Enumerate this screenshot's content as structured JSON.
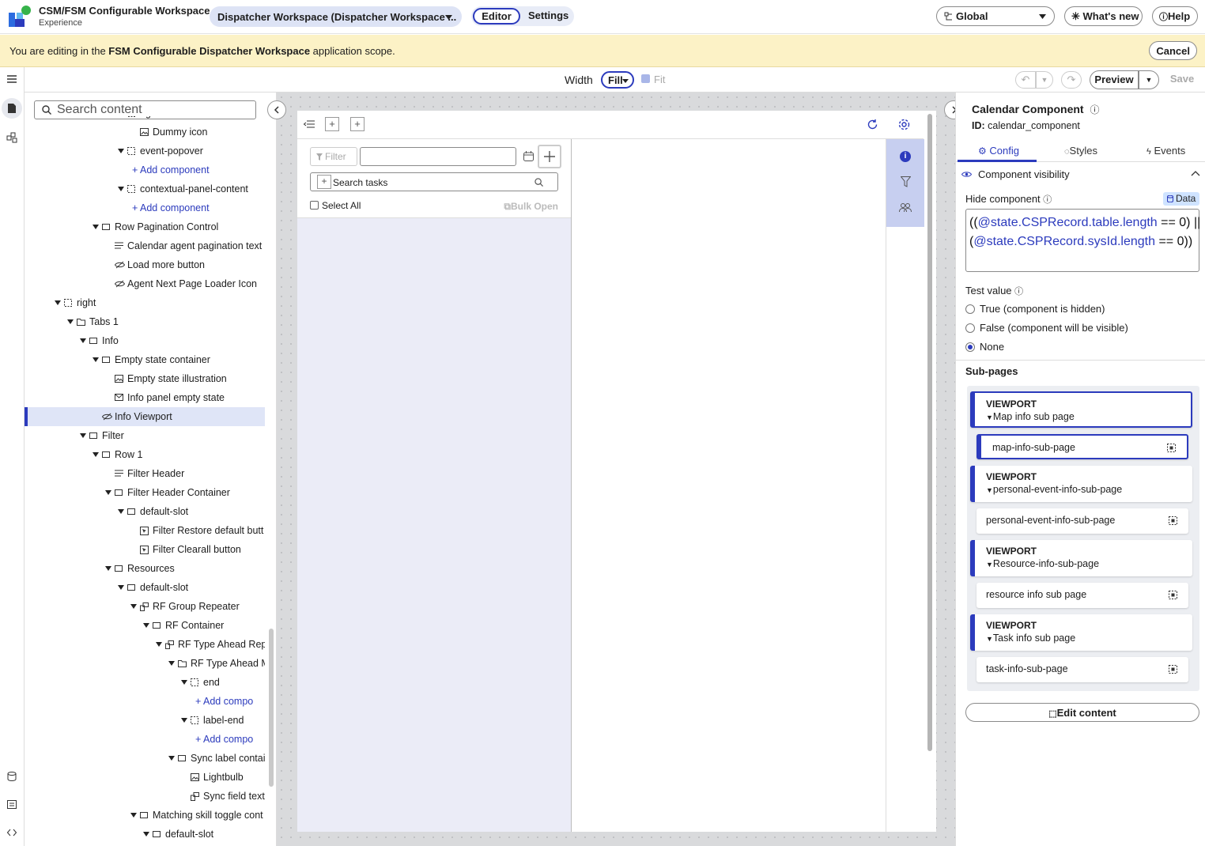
{
  "header": {
    "app_title": "CSM/FSM Configurable Workspace",
    "app_subtitle": "Experience",
    "workspace": "Dispatcher Workspace (Dispatcher Workspace ...",
    "editor_label": "Editor",
    "settings_label": "Settings",
    "scope": "Global",
    "whats_new": "What's new",
    "help": "Help"
  },
  "banner": {
    "prefix": "You are editing in the ",
    "app": "FSM Configurable Dispatcher Workspace",
    "suffix": " application scope.",
    "cancel": "Cancel"
  },
  "toolbar": {
    "width_label": "Width",
    "width_value": "Fill",
    "fit_label": "Fit",
    "preview": "Preview",
    "save": "Save"
  },
  "sidebar": {
    "search_placeholder": "Search content",
    "tree": [
      {
        "label": "right header btns",
        "icon": "slot",
        "level": 6,
        "twisty": "none"
      },
      {
        "label": "Dummy icon",
        "icon": "image",
        "level": 7,
        "twisty": "none"
      },
      {
        "label": "event-popover",
        "icon": "slot",
        "level": 6,
        "twisty": "open"
      },
      {
        "label": "Add component",
        "icon": "add",
        "level": 7,
        "twisty": "none"
      },
      {
        "label": "contextual-panel-content",
        "icon": "slot",
        "level": 6,
        "twisty": "open"
      },
      {
        "label": "Add component",
        "icon": "add",
        "level": 7,
        "twisty": "none"
      },
      {
        "label": "Row Pagination Control",
        "icon": "box",
        "level": 4,
        "twisty": "open"
      },
      {
        "label": "Calendar agent pagination text",
        "icon": "text",
        "level": 5,
        "twisty": "none"
      },
      {
        "label": "Load more button",
        "icon": "hidden",
        "level": 5,
        "twisty": "none"
      },
      {
        "label": "Agent Next Page Loader Icon",
        "icon": "hidden",
        "level": 5,
        "twisty": "none"
      },
      {
        "label": "right",
        "icon": "slot",
        "level": 1,
        "twisty": "open"
      },
      {
        "label": "Tabs 1",
        "icon": "folder",
        "level": 2,
        "twisty": "open"
      },
      {
        "label": "Info",
        "icon": "box",
        "level": 3,
        "twisty": "open"
      },
      {
        "label": "Empty state container",
        "icon": "box",
        "level": 4,
        "twisty": "open"
      },
      {
        "label": "Empty state illustration",
        "icon": "image",
        "level": 5,
        "twisty": "none"
      },
      {
        "label": "Info panel empty state",
        "icon": "mail",
        "level": 5,
        "twisty": "none"
      },
      {
        "label": "Info Viewport",
        "icon": "hidden",
        "level": 4,
        "twisty": "none",
        "selected": true
      },
      {
        "label": "Filter",
        "icon": "box",
        "level": 3,
        "twisty": "open"
      },
      {
        "label": "Row 1",
        "icon": "box",
        "level": 4,
        "twisty": "open"
      },
      {
        "label": "Filter Header",
        "icon": "text",
        "level": 5,
        "twisty": "none"
      },
      {
        "label": "Filter Header Container",
        "icon": "box",
        "level": 5,
        "twisty": "open"
      },
      {
        "label": "default-slot",
        "icon": "box",
        "level": 6,
        "twisty": "open"
      },
      {
        "label": "Filter Restore default butt",
        "icon": "button",
        "level": 7,
        "twisty": "none"
      },
      {
        "label": "Filter Clearall button",
        "icon": "button",
        "level": 7,
        "twisty": "none"
      },
      {
        "label": "Resources",
        "icon": "box",
        "level": 5,
        "twisty": "open"
      },
      {
        "label": "default-slot",
        "icon": "box",
        "level": 6,
        "twisty": "open"
      },
      {
        "label": "RF Group Repeater",
        "icon": "repeater",
        "level": 7,
        "twisty": "open"
      },
      {
        "label": "RF Container",
        "icon": "box",
        "level": 8,
        "twisty": "open"
      },
      {
        "label": "RF Type Ahead Repe",
        "icon": "repeater",
        "level": 9,
        "twisty": "open"
      },
      {
        "label": "RF Type Ahead M",
        "icon": "folder",
        "level": 10,
        "twisty": "open"
      },
      {
        "label": "end",
        "icon": "slot",
        "level": 11,
        "twisty": "open"
      },
      {
        "label": "Add compo",
        "icon": "add",
        "level": 12,
        "twisty": "none"
      },
      {
        "label": "label-end",
        "icon": "slot",
        "level": 11,
        "twisty": "open"
      },
      {
        "label": "Add compo",
        "icon": "add",
        "level": 12,
        "twisty": "none"
      },
      {
        "label": "Sync label contai",
        "icon": "box",
        "level": 10,
        "twisty": "open"
      },
      {
        "label": "Lightbulb",
        "icon": "image",
        "level": 11,
        "twisty": "none"
      },
      {
        "label": "Sync field text",
        "icon": "repeater",
        "level": 11,
        "twisty": "none"
      },
      {
        "label": "Matching skill toggle cont",
        "icon": "box",
        "level": 7,
        "twisty": "open"
      },
      {
        "label": "default-slot",
        "icon": "box",
        "level": 8,
        "twisty": "open"
      }
    ]
  },
  "canvas": {
    "filter_label": "Filter",
    "search_tasks": "Search tasks",
    "select_all": "Select All",
    "bulk_open": "Bulk Open"
  },
  "panel": {
    "title": "Calendar Component",
    "id_label": "ID:",
    "id_value": "calendar_component",
    "tabs": [
      "Config",
      "Styles",
      "Events"
    ],
    "visibility_section": "Component visibility",
    "hide_label": "Hide component",
    "data_tag": "Data",
    "code_line1_a": "((",
    "code_line1_var": "@state.CSPRecord.table.length",
    "code_line1_b": " == 0) ||",
    "code_line2_a": "(",
    "code_line2_var": "@state.CSPRecord.sysId.length",
    "code_line2_b": " == 0))",
    "test_value_label": "Test value",
    "radio_true": "True (component is hidden)",
    "radio_false": "False (component will be visible)",
    "radio_none": "None",
    "subpages_label": "Sub-pages",
    "viewports": [
      {
        "kind": "VIEWPORT",
        "name": "Map info sub page",
        "page": "map-info-sub-page",
        "active": true
      },
      {
        "kind": "VIEWPORT",
        "name": "personal-event-info-sub-page",
        "page": "personal-event-info-sub-page",
        "active": false
      },
      {
        "kind": "VIEWPORT",
        "name": "Resource-info-sub-page",
        "page": "resource info sub page",
        "active": false
      },
      {
        "kind": "VIEWPORT",
        "name": "Task info sub page",
        "page": "task-info-sub-page",
        "active": false
      }
    ],
    "edit_content": "Edit content"
  },
  "colors": {
    "accent": "#2c3bbd",
    "banner": "#fcf2c6",
    "selected_row": "#dfe5f7"
  }
}
